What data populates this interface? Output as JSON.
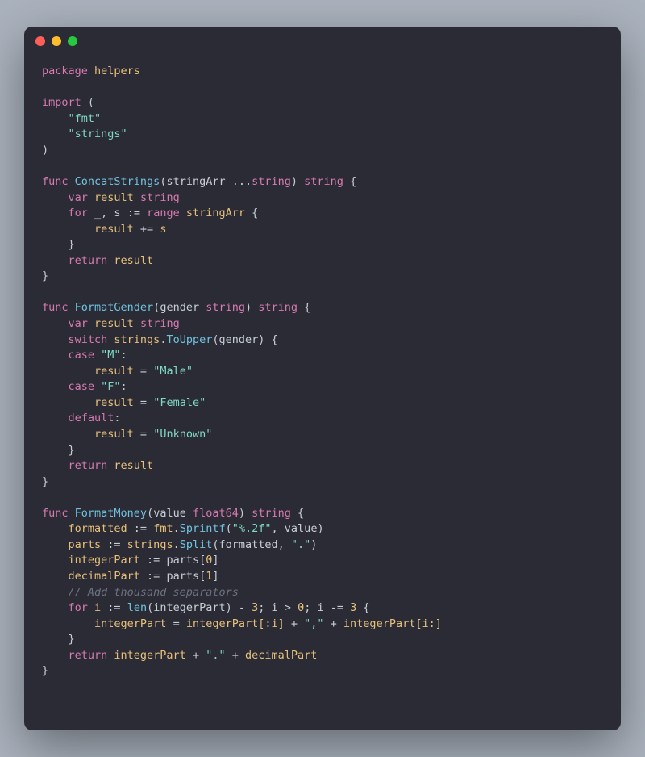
{
  "code": {
    "l1": {
      "kw": "package",
      "id": " helpers"
    },
    "l3": {
      "kw": "import",
      "pl": " ("
    },
    "l4": {
      "str": "    \"fmt\""
    },
    "l5": {
      "str": "    \"strings\""
    },
    "l6": {
      "pl": ")"
    },
    "l8": {
      "kw1": "func",
      "fn": " ConcatStrings",
      "pl1": "(stringArr ...",
      "kw2": "string",
      "pl2": ") ",
      "kw3": "string",
      "pl3": " {"
    },
    "l9": {
      "kw1": "    var",
      "id": " result ",
      "kw2": "string"
    },
    "l10": {
      "kw1": "    for",
      "pl1": " _, s ",
      "op": ":=",
      "kw2": " range",
      "id": " stringArr",
      "pl2": " {"
    },
    "l11": {
      "id1": "        result ",
      "op": "+=",
      "id2": " s"
    },
    "l12": {
      "pl": "    }"
    },
    "l13": {
      "kw": "    return",
      "id": " result"
    },
    "l14": {
      "pl": "}"
    },
    "l16": {
      "kw1": "func",
      "fn": " FormatGender",
      "pl1": "(gender ",
      "kw2": "string",
      "pl2": ") ",
      "kw3": "string",
      "pl3": " {"
    },
    "l17": {
      "kw1": "    var",
      "id": " result ",
      "kw2": "string"
    },
    "l18": {
      "kw": "    switch",
      "id1": " strings",
      "pl1": ".",
      "fn": "ToUpper",
      "pl2": "(gender) {"
    },
    "l19": {
      "kw": "    case",
      "str": " \"M\"",
      "pl": ":"
    },
    "l20": {
      "id": "        result ",
      "op": "=",
      "str": " \"Male\""
    },
    "l21": {
      "kw": "    case",
      "str": " \"F\"",
      "pl": ":"
    },
    "l22": {
      "id": "        result ",
      "op": "=",
      "str": " \"Female\""
    },
    "l23": {
      "kw": "    default",
      "pl": ":"
    },
    "l24": {
      "id": "        result ",
      "op": "=",
      "str": " \"Unknown\""
    },
    "l25": {
      "pl": "    }"
    },
    "l26": {
      "kw": "    return",
      "id": " result"
    },
    "l27": {
      "pl": "}"
    },
    "l29": {
      "kw1": "func",
      "fn": " FormatMoney",
      "pl1": "(value ",
      "kw2": "float64",
      "pl2": ") ",
      "kw3": "string",
      "pl3": " {"
    },
    "l30": {
      "id1": "    formatted ",
      "op": ":=",
      "id2": " fmt",
      "pl1": ".",
      "fn": "Sprintf",
      "pl2": "(",
      "str": "\"%.2f\"",
      "pl3": ", value)"
    },
    "l31": {
      "id1": "    parts ",
      "op": ":=",
      "id2": " strings",
      "pl1": ".",
      "fn": "Split",
      "pl2": "(formatted, ",
      "str": "\".\"",
      "pl3": ")"
    },
    "l32": {
      "id": "    integerPart ",
      "op": ":=",
      "pl": " parts[",
      "num": "0",
      "pl2": "]"
    },
    "l33": {
      "id": "    decimalPart ",
      "op": ":=",
      "pl": " parts[",
      "num": "1",
      "pl2": "]"
    },
    "l34": {
      "cm": "    // Add thousand separators"
    },
    "l35": {
      "kw1": "    for",
      "id1": " i ",
      "op1": ":=",
      "fn": " len",
      "pl1": "(integerPart) ",
      "op2": "-",
      "num1": " 3",
      "pl2": "; i ",
      "op3": ">",
      "num2": " 0",
      "pl3": "; i ",
      "op4": "-=",
      "num3": " 3",
      "pl4": " {"
    },
    "l36": {
      "id1": "        integerPart ",
      "op1": "=",
      "id2": " integerPart[:i] ",
      "op2": "+",
      "str": " \",\"",
      "op3": " +",
      "id3": " integerPart[i:]"
    },
    "l37": {
      "pl": "    }"
    },
    "l38": {
      "kw": "    return",
      "id1": " integerPart ",
      "op1": "+",
      "str": " \".\"",
      "op2": " +",
      "id2": " decimalPart"
    },
    "l39": {
      "pl": "}"
    }
  }
}
